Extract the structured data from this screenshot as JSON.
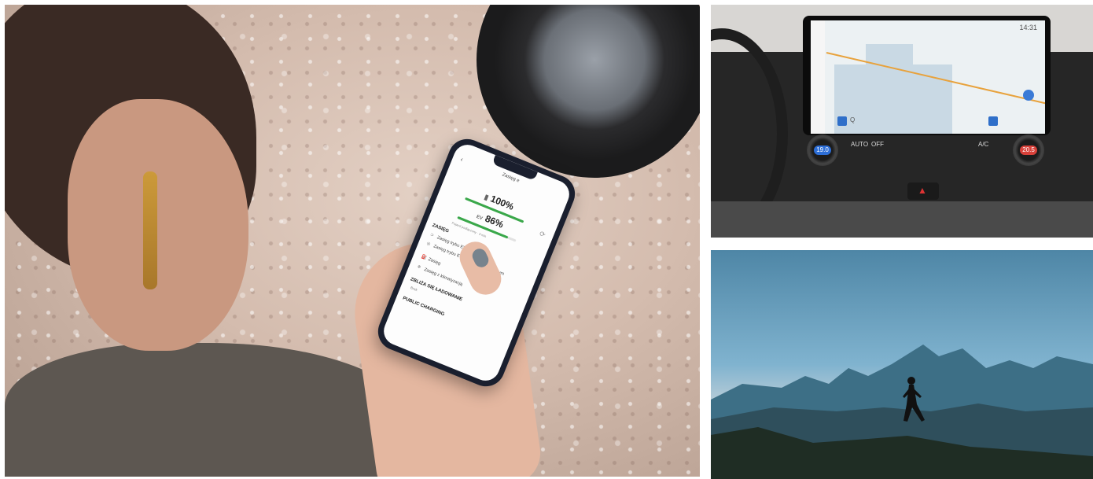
{
  "phone_app": {
    "title": "Zasięg e",
    "battery_level": "100%",
    "ev_charge": "86%",
    "ev_label": "EV",
    "note": "Pojazd podłączony · 3 min",
    "range_heading": "ZASIĘG",
    "rows": [
      "Zasięg trybu EV",
      "Zasięg trybu EV z silnikiem spalinowym",
      "Zasięg",
      "Zasięg z klimatyzacją"
    ],
    "charge_heading": "ZBLIŻA SIĘ ŁADOWANIE",
    "charge_sub": "Brak",
    "public_heading": "PUBLIC CHARGING",
    "battery_fill": 1.0,
    "ev_fill": 0.86
  },
  "infotainment": {
    "clock": "14:31",
    "left_temp": "19.0",
    "right_temp": "20.5",
    "auto_label": "AUTO",
    "off_label": "OFF",
    "ac_label": "A/C",
    "search_placeholder": "Q"
  },
  "colors": {
    "accent_green": "#3aa84a",
    "road_orange": "#e8a23c",
    "map_blue": "#2f6fc9",
    "temp_blue": "#2d6ed6",
    "temp_red": "#d8413a"
  },
  "icons": [
    "back-icon",
    "sync-icon",
    "battery-icon",
    "ev-plug-icon",
    "hazard-icon",
    "search-icon",
    "mic-icon"
  ]
}
